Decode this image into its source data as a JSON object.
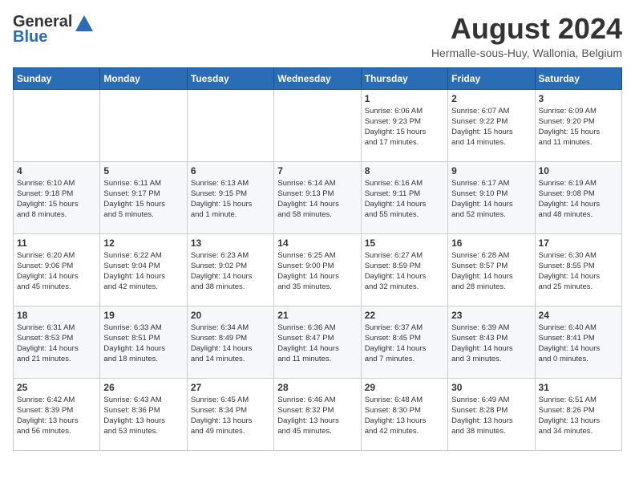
{
  "header": {
    "logo_general": "General",
    "logo_blue": "Blue",
    "month_year": "August 2024",
    "location": "Hermalle-sous-Huy, Wallonia, Belgium"
  },
  "days_of_week": [
    "Sunday",
    "Monday",
    "Tuesday",
    "Wednesday",
    "Thursday",
    "Friday",
    "Saturday"
  ],
  "weeks": [
    [
      {
        "day": "",
        "info": ""
      },
      {
        "day": "",
        "info": ""
      },
      {
        "day": "",
        "info": ""
      },
      {
        "day": "",
        "info": ""
      },
      {
        "day": "1",
        "info": "Sunrise: 6:06 AM\nSunset: 9:23 PM\nDaylight: 15 hours\nand 17 minutes."
      },
      {
        "day": "2",
        "info": "Sunrise: 6:07 AM\nSunset: 9:22 PM\nDaylight: 15 hours\nand 14 minutes."
      },
      {
        "day": "3",
        "info": "Sunrise: 6:09 AM\nSunset: 9:20 PM\nDaylight: 15 hours\nand 11 minutes."
      }
    ],
    [
      {
        "day": "4",
        "info": "Sunrise: 6:10 AM\nSunset: 9:18 PM\nDaylight: 15 hours\nand 8 minutes."
      },
      {
        "day": "5",
        "info": "Sunrise: 6:11 AM\nSunset: 9:17 PM\nDaylight: 15 hours\nand 5 minutes."
      },
      {
        "day": "6",
        "info": "Sunrise: 6:13 AM\nSunset: 9:15 PM\nDaylight: 15 hours\nand 1 minute."
      },
      {
        "day": "7",
        "info": "Sunrise: 6:14 AM\nSunset: 9:13 PM\nDaylight: 14 hours\nand 58 minutes."
      },
      {
        "day": "8",
        "info": "Sunrise: 6:16 AM\nSunset: 9:11 PM\nDaylight: 14 hours\nand 55 minutes."
      },
      {
        "day": "9",
        "info": "Sunrise: 6:17 AM\nSunset: 9:10 PM\nDaylight: 14 hours\nand 52 minutes."
      },
      {
        "day": "10",
        "info": "Sunrise: 6:19 AM\nSunset: 9:08 PM\nDaylight: 14 hours\nand 48 minutes."
      }
    ],
    [
      {
        "day": "11",
        "info": "Sunrise: 6:20 AM\nSunset: 9:06 PM\nDaylight: 14 hours\nand 45 minutes."
      },
      {
        "day": "12",
        "info": "Sunrise: 6:22 AM\nSunset: 9:04 PM\nDaylight: 14 hours\nand 42 minutes."
      },
      {
        "day": "13",
        "info": "Sunrise: 6:23 AM\nSunset: 9:02 PM\nDaylight: 14 hours\nand 38 minutes."
      },
      {
        "day": "14",
        "info": "Sunrise: 6:25 AM\nSunset: 9:00 PM\nDaylight: 14 hours\nand 35 minutes."
      },
      {
        "day": "15",
        "info": "Sunrise: 6:27 AM\nSunset: 8:59 PM\nDaylight: 14 hours\nand 32 minutes."
      },
      {
        "day": "16",
        "info": "Sunrise: 6:28 AM\nSunset: 8:57 PM\nDaylight: 14 hours\nand 28 minutes."
      },
      {
        "day": "17",
        "info": "Sunrise: 6:30 AM\nSunset: 8:55 PM\nDaylight: 14 hours\nand 25 minutes."
      }
    ],
    [
      {
        "day": "18",
        "info": "Sunrise: 6:31 AM\nSunset: 8:53 PM\nDaylight: 14 hours\nand 21 minutes."
      },
      {
        "day": "19",
        "info": "Sunrise: 6:33 AM\nSunset: 8:51 PM\nDaylight: 14 hours\nand 18 minutes."
      },
      {
        "day": "20",
        "info": "Sunrise: 6:34 AM\nSunset: 8:49 PM\nDaylight: 14 hours\nand 14 minutes."
      },
      {
        "day": "21",
        "info": "Sunrise: 6:36 AM\nSunset: 8:47 PM\nDaylight: 14 hours\nand 11 minutes."
      },
      {
        "day": "22",
        "info": "Sunrise: 6:37 AM\nSunset: 8:45 PM\nDaylight: 14 hours\nand 7 minutes."
      },
      {
        "day": "23",
        "info": "Sunrise: 6:39 AM\nSunset: 8:43 PM\nDaylight: 14 hours\nand 3 minutes."
      },
      {
        "day": "24",
        "info": "Sunrise: 6:40 AM\nSunset: 8:41 PM\nDaylight: 14 hours\nand 0 minutes."
      }
    ],
    [
      {
        "day": "25",
        "info": "Sunrise: 6:42 AM\nSunset: 8:39 PM\nDaylight: 13 hours\nand 56 minutes."
      },
      {
        "day": "26",
        "info": "Sunrise: 6:43 AM\nSunset: 8:36 PM\nDaylight: 13 hours\nand 53 minutes."
      },
      {
        "day": "27",
        "info": "Sunrise: 6:45 AM\nSunset: 8:34 PM\nDaylight: 13 hours\nand 49 minutes."
      },
      {
        "day": "28",
        "info": "Sunrise: 6:46 AM\nSunset: 8:32 PM\nDaylight: 13 hours\nand 45 minutes."
      },
      {
        "day": "29",
        "info": "Sunrise: 6:48 AM\nSunset: 8:30 PM\nDaylight: 13 hours\nand 42 minutes."
      },
      {
        "day": "30",
        "info": "Sunrise: 6:49 AM\nSunset: 8:28 PM\nDaylight: 13 hours\nand 38 minutes."
      },
      {
        "day": "31",
        "info": "Sunrise: 6:51 AM\nSunset: 8:26 PM\nDaylight: 13 hours\nand 34 minutes."
      }
    ]
  ]
}
